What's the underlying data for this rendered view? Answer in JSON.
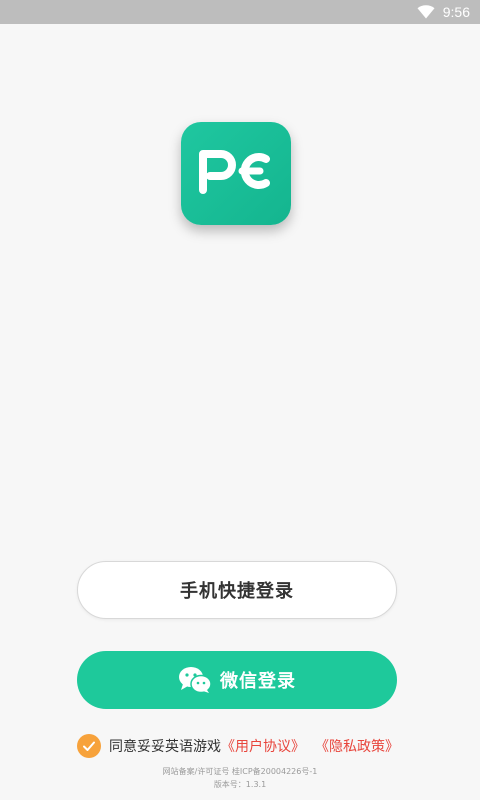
{
  "status_bar": {
    "time": "9:56",
    "icons": [
      "wifi-icon"
    ]
  },
  "logo": {
    "text": "PE",
    "color": "#1ec29c"
  },
  "buttons": {
    "phone_login_label": "手机快捷登录",
    "wechat_login_label": "微信登录",
    "wechat_icon": "wechat-icon",
    "wechat_color": "#1ec99b"
  },
  "agreement": {
    "checked": true,
    "text": "同意妥妥英语游戏",
    "user_agreement": "《用户协议》",
    "privacy_policy": "《隐私政策》",
    "link_color": "#e8453c",
    "check_color": "#f7a23b"
  },
  "footer": {
    "license": "网站备案/许可证号  桂ICP备20004226号-1",
    "version": "版本号：1.3.1"
  }
}
